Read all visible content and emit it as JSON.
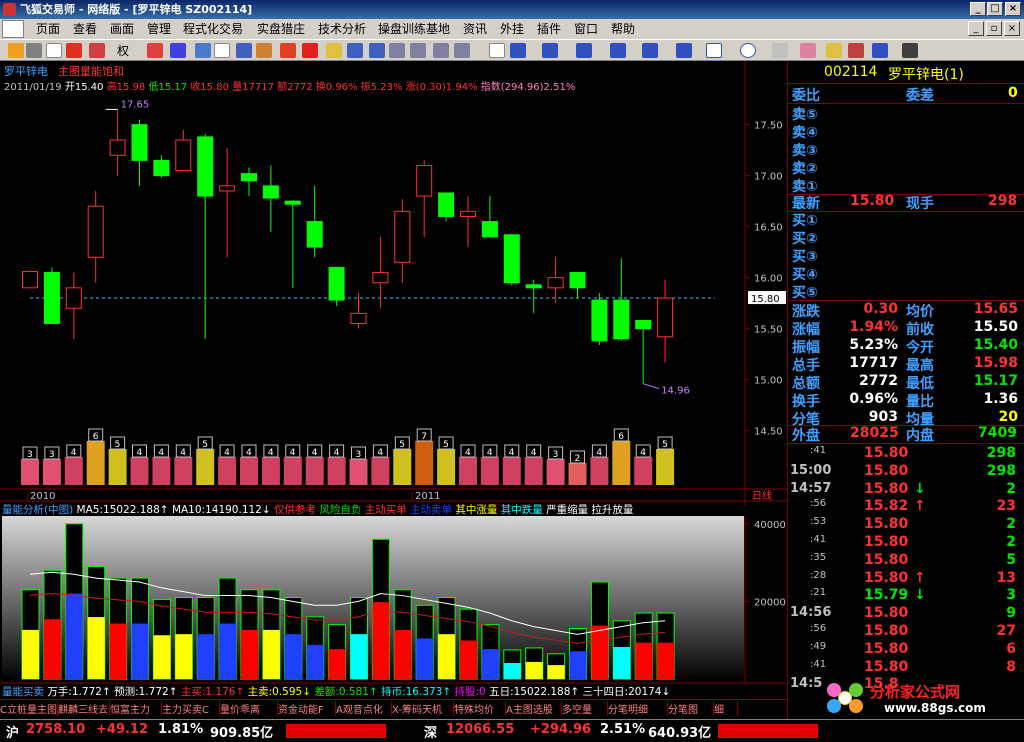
{
  "window": {
    "title": "飞狐交易师 - 网络版 - [罗平锌电 SZ002114]"
  },
  "menu": [
    "页面",
    "查看",
    "画面",
    "管理",
    "程式化交易",
    "实盘猎庄",
    "技术分析",
    "操盘训练基地",
    "资讯",
    "外挂",
    "插件",
    "窗口",
    "帮助"
  ],
  "toolbar": {
    "period_label": "权"
  },
  "chart": {
    "name": "罗平锌电",
    "indicator": "主图量能饱和",
    "info": {
      "date": "2011/01/19",
      "open": "开15.40",
      "high": "高15.98",
      "low": "低15.17",
      "close": "收15.80",
      "vol": "量17717",
      "amt": "额2772",
      "turnover": "换0.96%",
      "amplitude": "振5.23%",
      "change": "涨(0.30)1.94%",
      "index": "指数(294.96)2.51%"
    },
    "yticks": [
      "17.50",
      "17.00",
      "16.50",
      "16.00",
      "15.50",
      "15.00",
      "14.50"
    ],
    "ylim": [
      14.3,
      17.85
    ],
    "last_price": "15.80",
    "max_label": "17.65",
    "min_label": "14.96",
    "candles": [
      [
        15.9,
        16.06,
        16.06,
        15.9
      ],
      [
        16.05,
        15.55,
        16.1,
        15.55
      ],
      [
        15.7,
        15.9,
        16.05,
        15.4
      ],
      [
        16.2,
        16.7,
        16.85,
        15.95
      ],
      [
        17.2,
        17.35,
        17.65,
        17.0
      ],
      [
        17.5,
        17.15,
        17.55,
        16.9
      ],
      [
        17.15,
        17.0,
        17.2,
        16.98
      ],
      [
        17.05,
        17.35,
        17.45,
        17.05
      ],
      [
        17.38,
        16.8,
        17.41,
        15.4
      ],
      [
        16.85,
        16.9,
        17.27,
        16.2
      ],
      [
        17.02,
        16.95,
        17.08,
        16.8
      ],
      [
        16.9,
        16.78,
        17.1,
        16.45
      ],
      [
        16.75,
        16.72,
        16.76,
        15.9
      ],
      [
        16.55,
        16.3,
        16.9,
        16.2
      ],
      [
        16.1,
        15.78,
        16.1,
        15.72
      ],
      [
        15.55,
        15.65,
        15.85,
        15.5
      ],
      [
        15.95,
        16.05,
        16.4,
        15.7
      ],
      [
        16.15,
        16.65,
        16.77,
        15.95
      ],
      [
        16.8,
        17.1,
        17.15,
        16.4
      ],
      [
        16.83,
        16.6,
        16.83,
        16.55
      ],
      [
        16.6,
        16.65,
        16.8,
        16.3
      ],
      [
        16.55,
        16.4,
        16.8,
        16.4
      ],
      [
        16.42,
        15.95,
        16.43,
        15.92
      ],
      [
        15.93,
        15.9,
        15.98,
        15.65
      ],
      [
        15.9,
        16.0,
        16.2,
        15.75
      ],
      [
        16.05,
        15.9,
        16.05,
        15.8
      ],
      [
        15.78,
        15.38,
        15.85,
        15.34
      ],
      [
        15.78,
        15.4,
        16.19,
        15.38
      ],
      [
        15.58,
        15.5,
        15.58,
        14.96
      ],
      [
        15.42,
        15.8,
        15.98,
        15.17
      ]
    ],
    "volbadges": [
      "3",
      "3",
      "4",
      "6",
      "5",
      "4",
      "4",
      "4",
      "5",
      "4",
      "4",
      "4",
      "4",
      "4",
      "4",
      "3",
      "4",
      "5",
      "7",
      "5",
      "4",
      "4",
      "4",
      "4",
      "3",
      "2",
      "4",
      "6",
      "4",
      "5"
    ],
    "dates": [
      "2010",
      "2011"
    ],
    "period": "日线"
  },
  "vol_panel": {
    "title": "量能分析(中图)",
    "ma5": "MA5:15022.188↑",
    "ma10": "MA10:14190.112↓",
    "legend": [
      "仅供参考",
      "风险自负",
      "主动买单",
      "主动卖单",
      "其中涨量",
      "其中跌量",
      "严重缩量",
      "拉升放量"
    ],
    "yticks": [
      "40000",
      "20000"
    ],
    "ylim": [
      0,
      42000
    ],
    "bars": [
      23000,
      28000,
      33000,
      40000,
      29000,
      26000,
      24000,
      20500,
      26000,
      21000,
      21000,
      26000,
      23000,
      24000,
      21000,
      17000,
      15000,
      8000,
      19000,
      34000,
      33000,
      11000,
      20000,
      24000,
      13500,
      17000,
      24500,
      8500,
      14000,
      18000,
      20000,
      15000,
      14000,
      18000,
      36000,
      9000,
      8000,
      17000,
      21000,
      8000,
      7500,
      10000,
      14000,
      12000,
      7500,
      8000,
      10000,
      28000,
      16000,
      13000,
      15000,
      19000,
      24000,
      20000,
      20000,
      23000,
      15000,
      15000,
      16000,
      20000
    ],
    "values": [
      23000,
      28000,
      40000,
      29000,
      26000,
      26000,
      20500,
      21000,
      21000,
      26000,
      23000,
      23000,
      21000,
      16000,
      14000,
      21000,
      36000,
      23000,
      19000,
      21000,
      18000,
      14000,
      7500,
      8000,
      6500,
      13000,
      25000,
      15000,
      17000,
      17000
    ],
    "ma": [
      27000,
      27500,
      27000,
      26000,
      25500,
      25000,
      23500,
      22500,
      21500,
      21500,
      21500,
      21000,
      20000,
      19000,
      19000,
      20000,
      22000,
      21500,
      20500,
      19500,
      18500,
      17000,
      15000,
      13500,
      12500,
      11500,
      12500,
      13500,
      14500,
      15000
    ]
  },
  "bottom_panel": {
    "title": "量能买卖",
    "items": [
      "万手:1.772↑",
      "预测:1.772↑",
      "主买:1.176↑",
      "主卖:0.595↓",
      "差额:0.581↑",
      "持币:16.373↑",
      "持股:0",
      "五日:15022.188↑",
      "三十四日:20174↓"
    ]
  },
  "tabs": [
    "C立桩量主图",
    "麒麟三线去",
    "恒富主力",
    "主力买卖C",
    "量价乖离",
    "资金动能F",
    "A观音点化",
    "X-筹码天机",
    "特殊均价",
    "A主图选股",
    "多空量",
    "分笔明细",
    "分笔图",
    "细"
  ],
  "quote": {
    "code": "002114",
    "name": "罗平锌电(1)",
    "weibi_label": "委比",
    "weicha_label": "委差",
    "weicha": "0",
    "sells": [
      "卖⑤",
      "卖④",
      "卖③",
      "卖②",
      "卖①"
    ],
    "buys": [
      "买①",
      "买②",
      "买③",
      "买④",
      "买⑤"
    ],
    "latest_label": "最新",
    "latest": "15.80",
    "xianshou_label": "现手",
    "xianshou": "298",
    "stats": [
      [
        "涨跌",
        "0.30",
        "均价",
        "15.65"
      ],
      [
        "涨幅",
        "1.94%",
        "前收",
        "15.50"
      ],
      [
        "振幅",
        "5.23%",
        "今开",
        "15.40"
      ],
      [
        "总手",
        "17717",
        "最高",
        "15.98"
      ],
      [
        "总额",
        "2772",
        "最低",
        "15.17"
      ],
      [
        "换手",
        "0.96%",
        "量比",
        "1.36"
      ],
      [
        "分笔",
        "903",
        "均量",
        "20"
      ]
    ],
    "waipan_label": "外盘",
    "waipan": "28025",
    "neipan_label": "内盘",
    "neipan": "7409",
    "ticks": [
      [
        ":41",
        "15.80",
        "",
        "298"
      ],
      [
        "15:00",
        "15.80",
        "",
        "298"
      ],
      [
        "14:57",
        "15.80",
        "↓",
        "2"
      ],
      [
        ":56",
        "15.82",
        "↑",
        "23"
      ],
      [
        ":53",
        "15.80",
        "",
        "2"
      ],
      [
        ":41",
        "15.80",
        "",
        "2"
      ],
      [
        ":35",
        "15.80",
        "",
        "5"
      ],
      [
        ":28",
        "15.80",
        "↑",
        "13"
      ],
      [
        ":21",
        "15.79",
        "↓",
        "3"
      ],
      [
        "14:56",
        "15.80",
        "",
        "9"
      ],
      [
        ":56",
        "15.80",
        "",
        "27"
      ],
      [
        ":49",
        "15.80",
        "",
        "6"
      ],
      [
        ":41",
        "15.80",
        "",
        "8"
      ],
      [
        "14:5",
        "15.8",
        "",
        " "
      ]
    ]
  },
  "status": {
    "sh_label": "沪",
    "sh_index": "2758.10",
    "sh_chg": "+49.12",
    "sh_pct": "1.81%",
    "sh_amt": "909.85亿",
    "sz_label": "深",
    "sz_index": "12066.55",
    "sz_chg": "+294.96",
    "sz_pct": "2.51%",
    "sz_amt": "640.93亿"
  },
  "watermark": {
    "text": "分析家公式网",
    "url": "www.88gs.com"
  }
}
